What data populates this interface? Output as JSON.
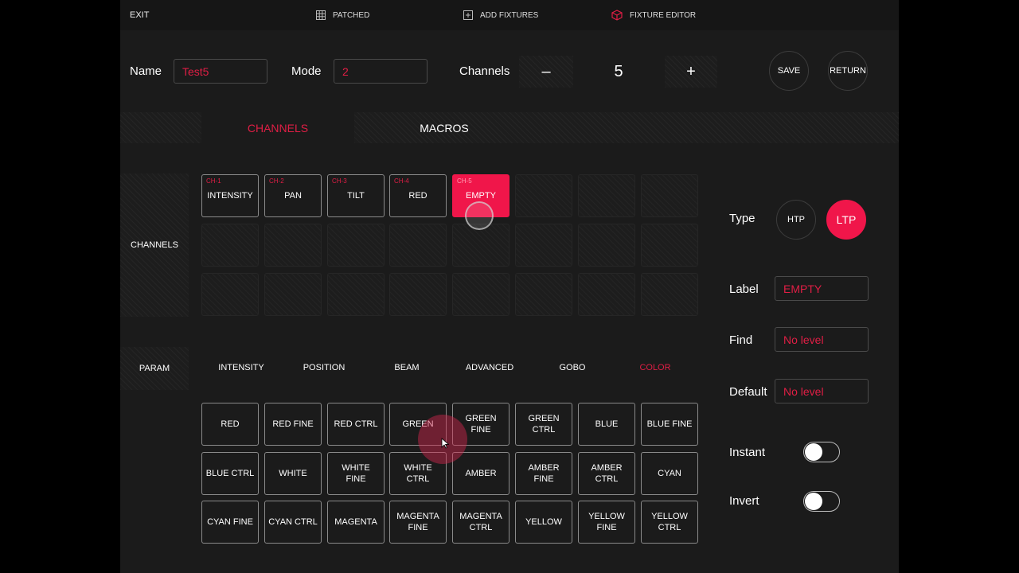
{
  "topbar": {
    "exit": "EXIT",
    "patched": "PATCHED",
    "add_fixtures": "ADD FIXTURES",
    "fixture_editor": "FIXTURE EDITOR"
  },
  "header": {
    "name_label": "Name",
    "name_value": "Test5",
    "mode_label": "Mode",
    "mode_value": "2",
    "channels_label": "Channels",
    "minus": "–",
    "channel_count": "5",
    "plus": "+",
    "save": "SAVE",
    "return": "RETURN"
  },
  "tabs": {
    "channels": "CHANNELS",
    "macros": "MACROS"
  },
  "channels_section": {
    "label": "CHANNELS",
    "items": [
      {
        "ch": "CH-1",
        "name": "INTENSITY"
      },
      {
        "ch": "CH-2",
        "name": "PAN"
      },
      {
        "ch": "CH-3",
        "name": "TILT"
      },
      {
        "ch": "CH-4",
        "name": "RED"
      },
      {
        "ch": "CH-5",
        "name": "EMPTY"
      }
    ]
  },
  "param_section": {
    "label": "PARAM",
    "categories": [
      "INTENSITY",
      "POSITION",
      "BEAM",
      "ADVANCED",
      "GOBO",
      "COLOR"
    ],
    "selected_category": "COLOR",
    "buttons": [
      "RED",
      "RED FINE",
      "RED CTRL",
      "GREEN",
      "GREEN FINE",
      "GREEN CTRL",
      "BLUE",
      "BLUE FINE",
      "BLUE CTRL",
      "WHITE",
      "WHITE FINE",
      "WHITE CTRL",
      "AMBER",
      "AMBER FINE",
      "AMBER CTRL",
      "CYAN",
      "CYAN FINE",
      "CYAN CTRL",
      "MAGENTA",
      "MAGENTA FINE",
      "MAGENTA CTRL",
      "YELLOW",
      "YELLOW FINE",
      "YELLOW CTRL"
    ]
  },
  "right_panel": {
    "type_label": "Type",
    "htp": "HTP",
    "ltp": "LTP",
    "label_label": "Label",
    "label_value": "EMPTY",
    "find_label": "Find",
    "find_value": "No level",
    "default_label": "Default",
    "default_value": "No level",
    "instant_label": "Instant",
    "invert_label": "Invert"
  },
  "colors": {
    "accent": "#f0164a",
    "accent_text": "#e01e45",
    "background": "#1b1b1b"
  },
  "icons": {
    "patched": "grid-icon",
    "add_fixtures": "plus-box-icon",
    "fixture_editor": "cube-icon"
  }
}
